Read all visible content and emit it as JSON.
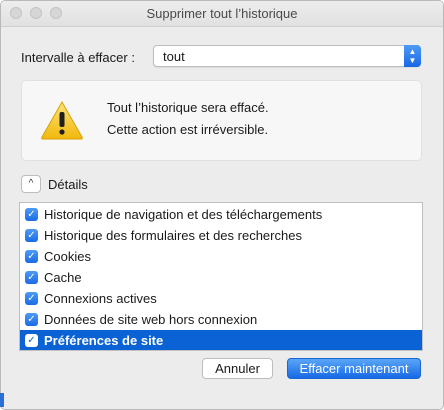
{
  "window": {
    "title": "Supprimer tout l’historique"
  },
  "range": {
    "label": "Intervalle à effacer :",
    "selected": "tout"
  },
  "warning": {
    "icon": "warning-triangle-icon",
    "line1": "Tout l’historique sera effacé.",
    "line2": "Cette action est irréversible."
  },
  "details": {
    "label": "Détails",
    "toggle_icon": "chevron-up-icon"
  },
  "items": [
    {
      "label": "Historique de navigation et des téléchargements",
      "checked": true,
      "selected": false
    },
    {
      "label": "Historique des formulaires et des recherches",
      "checked": true,
      "selected": false
    },
    {
      "label": "Cookies",
      "checked": true,
      "selected": false
    },
    {
      "label": "Cache",
      "checked": true,
      "selected": false
    },
    {
      "label": "Connexions actives",
      "checked": true,
      "selected": false
    },
    {
      "label": "Données de site web hors connexion",
      "checked": true,
      "selected": false
    },
    {
      "label": "Préférences de site",
      "checked": true,
      "selected": true
    }
  ],
  "buttons": {
    "cancel": "Annuler",
    "confirm": "Effacer maintenant"
  },
  "colors": {
    "accent": "#1769e6",
    "selection": "#0b62d4",
    "warning_yellow": "#f5c518"
  }
}
